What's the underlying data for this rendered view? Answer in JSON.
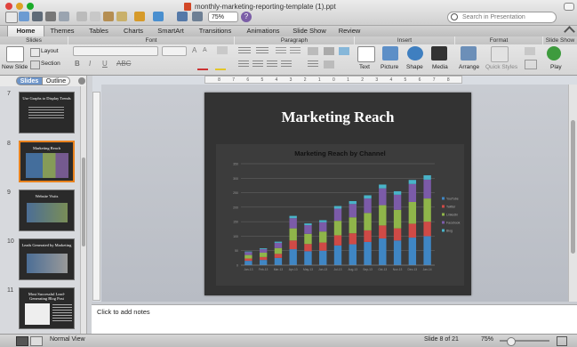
{
  "window": {
    "title": "monthly-marketing-reporting-template (1).ppt"
  },
  "toolbar": {
    "zoom": "75%",
    "search_placeholder": "Search in Presentation"
  },
  "tabs": [
    "Home",
    "Themes",
    "Tables",
    "Charts",
    "SmartArt",
    "Transitions",
    "Animations",
    "Slide Show",
    "Review"
  ],
  "ribbon": {
    "groups": [
      "Slides",
      "Font",
      "Paragraph",
      "Insert",
      "Format",
      "Slide Show"
    ],
    "new_slide": "New Slide",
    "layout": "Layout",
    "section": "Section",
    "text": "Text",
    "picture": "Picture",
    "shape": "Shape",
    "media": "Media",
    "arrange": "Arrange",
    "quick_styles": "Quick Styles",
    "play": "Play"
  },
  "sidebar": {
    "tab_slides": "Slides",
    "tab_outline": "Outline",
    "thumbs": [
      {
        "num": "7",
        "title": "Use Graphs to Display Trends"
      },
      {
        "num": "8",
        "title": "Marketing Reach"
      },
      {
        "num": "9",
        "title": "Website Visits"
      },
      {
        "num": "10",
        "title": "Leads Generated by Marketing"
      },
      {
        "num": "11",
        "title": "Most Successful Lead-Generating Blog Post"
      }
    ]
  },
  "ruler": {
    "ticks": [
      "8",
      "7",
      "6",
      "5",
      "4",
      "3",
      "2",
      "1",
      "0",
      "1",
      "2",
      "3",
      "4",
      "5",
      "6",
      "7",
      "8"
    ]
  },
  "slide": {
    "title": "Marketing Reach"
  },
  "chart_data": {
    "type": "bar",
    "stacked": true,
    "title": "Marketing Reach by Channel",
    "categories": [
      "Jan-13",
      "Feb-13",
      "Mar-13",
      "Apr-13",
      "May-13",
      "Jun-13",
      "Jul-13",
      "Aug-13",
      "Sep-13",
      "Oct-13",
      "Nov-13",
      "Dec-13",
      "Jan-14"
    ],
    "series": [
      {
        "name": "YouTube",
        "color": "#3f86c4",
        "values": [
          15,
          18,
          25,
          55,
          48,
          50,
          68,
          72,
          80,
          92,
          85,
          95,
          100
        ]
      },
      {
        "name": "Twitter",
        "color": "#cf4a46",
        "values": [
          8,
          10,
          14,
          30,
          25,
          28,
          35,
          38,
          40,
          45,
          42,
          48,
          50
        ]
      },
      {
        "name": "LinkedIn",
        "color": "#8fb54a",
        "values": [
          12,
          15,
          20,
          42,
          35,
          38,
          50,
          55,
          60,
          70,
          64,
          75,
          80
        ]
      },
      {
        "name": "Facebook",
        "color": "#7b5ba8",
        "values": [
          10,
          12,
          18,
          35,
          30,
          32,
          42,
          46,
          50,
          58,
          52,
          62,
          65
        ]
      },
      {
        "name": "Blog",
        "color": "#49b3c8",
        "values": [
          2,
          3,
          4,
          8,
          6,
          7,
          9,
          10,
          11,
          13,
          12,
          14,
          15
        ]
      }
    ],
    "ylim": [
      0,
      350
    ],
    "yticks": [
      "0",
      "50",
      "100",
      "150",
      "200",
      "250",
      "300",
      "350"
    ],
    "grid": true,
    "legend": "right"
  },
  "notes": {
    "placeholder": "Click to add notes"
  },
  "status": {
    "view": "Normal View",
    "slide": "Slide 8 of 21",
    "zoom": "75%"
  }
}
